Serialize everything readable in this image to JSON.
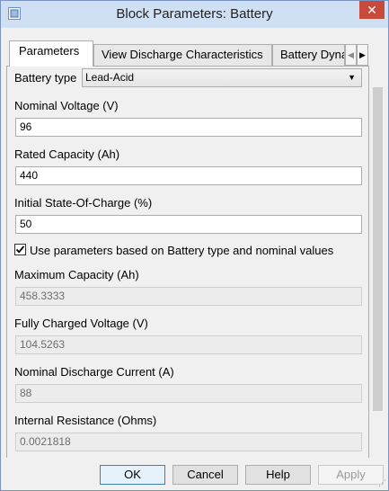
{
  "window": {
    "title": "Block Parameters: Battery"
  },
  "tabs": [
    {
      "label": "Parameters",
      "active": true
    },
    {
      "label": "View Discharge Characteristics",
      "active": false
    },
    {
      "label": "Battery Dyna",
      "active": false
    }
  ],
  "parameters": {
    "battery_type": {
      "label": "Battery type",
      "value": "Lead-Acid"
    },
    "nominal_voltage": {
      "label": "Nominal Voltage (V)",
      "value": "96"
    },
    "rated_capacity": {
      "label": "Rated Capacity (Ah)",
      "value": "440"
    },
    "initial_soc": {
      "label": "Initial State-Of-Charge (%)",
      "value": "50"
    },
    "use_preset": {
      "label": "Use parameters based on Battery type and nominal values",
      "checked": true
    },
    "maximum_capacity": {
      "label": "Maximum Capacity (Ah)",
      "value": "458.3333"
    },
    "fully_charged_voltage": {
      "label": "Fully Charged Voltage (V)",
      "value": "104.5263"
    },
    "nominal_discharge_current": {
      "label": "Nominal Discharge Current (A)",
      "value": "88"
    },
    "internal_resistance": {
      "label": "Internal Resistance (Ohms)",
      "value": "0.0021818"
    }
  },
  "buttons": {
    "ok": "OK",
    "cancel": "Cancel",
    "help": "Help",
    "apply": "Apply"
  },
  "colors": {
    "titlebar": "#cfe0f5",
    "close": "#c74a3a",
    "default_button_border": "#3c7fb1"
  }
}
